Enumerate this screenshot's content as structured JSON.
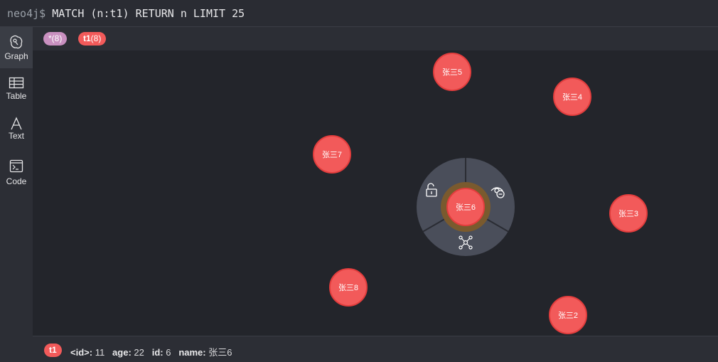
{
  "editor": {
    "prompt": "neo4j$",
    "query": "MATCH (n:t1) RETURN n LIMIT 25"
  },
  "sidebar": {
    "items": [
      {
        "label": "Graph",
        "icon": "graph-icon",
        "active": true
      },
      {
        "label": "Table",
        "icon": "table-icon"
      },
      {
        "label": "Text",
        "icon": "text-icon"
      },
      {
        "label": "Code",
        "icon": "code-icon"
      }
    ]
  },
  "labels": {
    "all": {
      "name": "*",
      "count": "(8)",
      "color": "#c990c0"
    },
    "t1": {
      "name": "t1",
      "count": "(8)",
      "color": "#f25a5a"
    }
  },
  "graph": {
    "nodes": [
      {
        "label": "张三5"
      },
      {
        "label": "张三4"
      },
      {
        "label": "张三7"
      },
      {
        "label": "张三6",
        "selected": true
      },
      {
        "label": "张三3"
      },
      {
        "label": "张三8"
      },
      {
        "label": "张三2"
      }
    ],
    "node_color": "#f25a5a",
    "ring_actions": [
      "unlock-icon",
      "hide-icon",
      "expand-icon"
    ]
  },
  "details": {
    "label": "t1",
    "props": [
      {
        "key": "<id>:",
        "value": "11"
      },
      {
        "key": "age:",
        "value": "22"
      },
      {
        "key": "id:",
        "value": "6"
      },
      {
        "key": "name:",
        "value": "张三6"
      }
    ]
  }
}
